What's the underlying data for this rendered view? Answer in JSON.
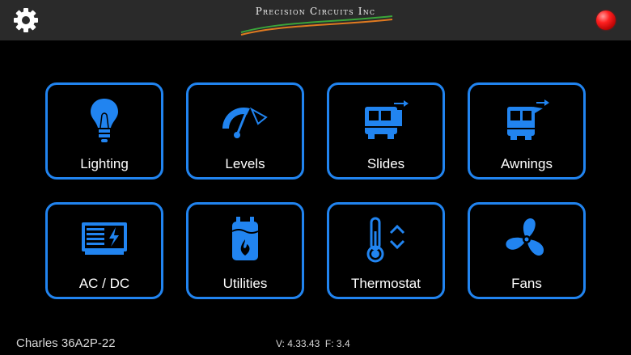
{
  "header": {
    "logo_text": "Precision Circuits Inc",
    "settings_icon": "gear-icon",
    "status_color": "#ff2020"
  },
  "accent_color": "#2184f0",
  "tiles": [
    {
      "label": "Lighting",
      "icon": "lightbulb-icon"
    },
    {
      "label": "Levels",
      "icon": "level-gauge-icon"
    },
    {
      "label": "Slides",
      "icon": "slide-out-icon"
    },
    {
      "label": "Awnings",
      "icon": "awning-icon"
    },
    {
      "label": "AC / DC",
      "icon": "power-panel-icon"
    },
    {
      "label": "Utilities",
      "icon": "water-heater-icon"
    },
    {
      "label": "Thermostat",
      "icon": "thermometer-icon"
    },
    {
      "label": "Fans",
      "icon": "fan-icon"
    }
  ],
  "footer": {
    "model": "Charles 36A2P-22",
    "version": "V: 4.33.43  F: 3.4"
  }
}
